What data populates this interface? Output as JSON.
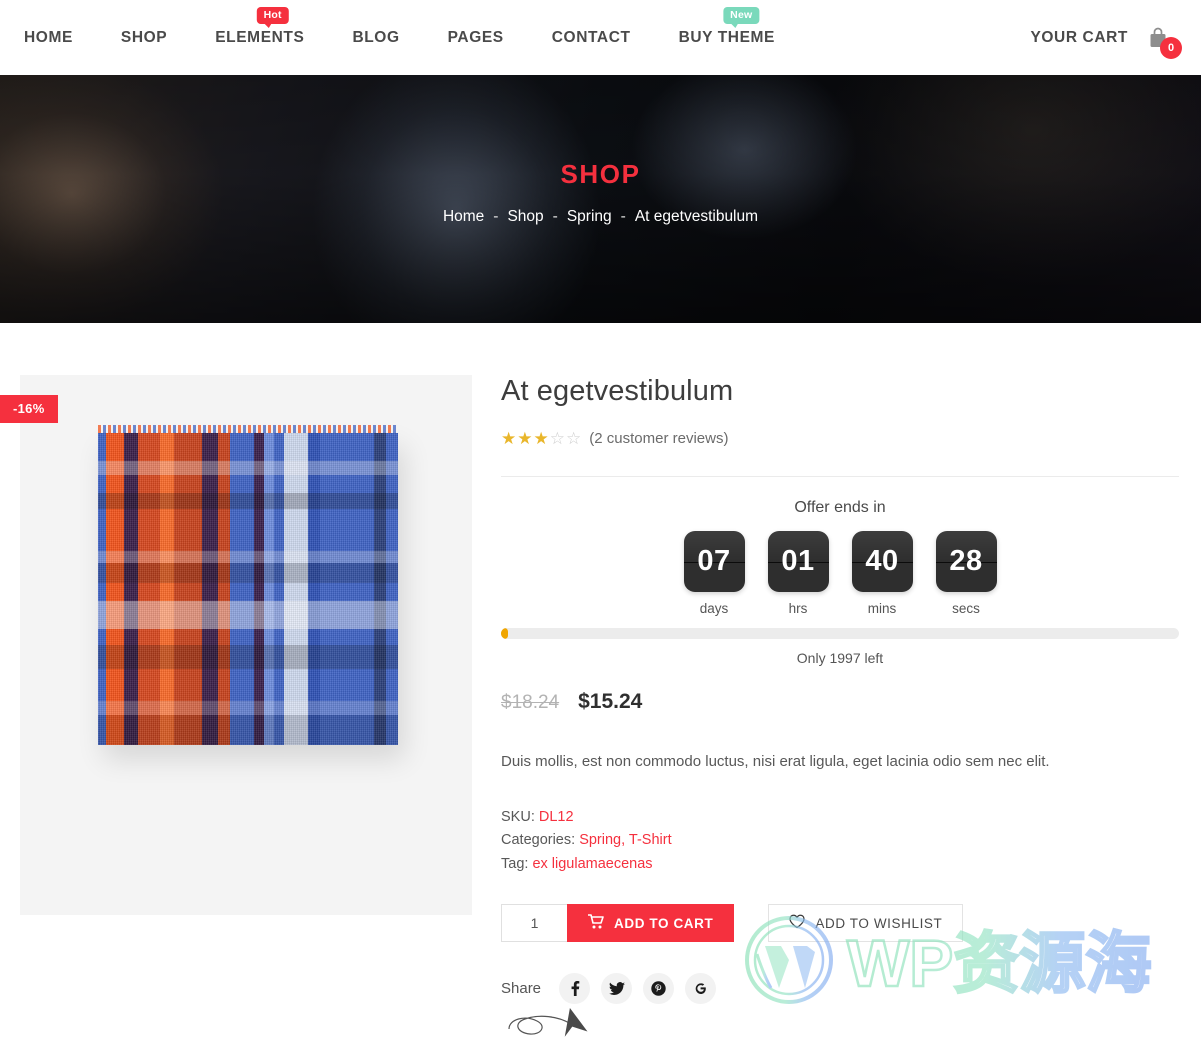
{
  "header": {
    "nav_items": [
      {
        "label": "HOME",
        "badge": null,
        "badge_type": null
      },
      {
        "label": "SHOP",
        "badge": null,
        "badge_type": null
      },
      {
        "label": "ELEMENTS",
        "badge": "Hot",
        "badge_type": "hot"
      },
      {
        "label": "BLOG",
        "badge": null,
        "badge_type": null
      },
      {
        "label": "PAGES",
        "badge": null,
        "badge_type": null
      },
      {
        "label": "CONTACT",
        "badge": null,
        "badge_type": null
      },
      {
        "label": "BUY THEME",
        "badge": "New",
        "badge_type": "new"
      }
    ],
    "cart_label": "YOUR CART",
    "cart_count": "0",
    "cart_icon": "shopping-bag-icon"
  },
  "hero": {
    "title": "SHOP",
    "breadcrumb": [
      {
        "label": "Home",
        "current": false
      },
      {
        "label": "Shop",
        "current": false
      },
      {
        "label": "Spring",
        "current": false
      },
      {
        "label": "At egetvestibulum",
        "current": true
      }
    ],
    "separator": "-"
  },
  "gallery": {
    "sale_badge": "-16%",
    "image_alt": "plaid-scarf-product-photo"
  },
  "product": {
    "title": "At egetvestibulum",
    "rating": {
      "value": 3,
      "max": 5,
      "reviews_text": "(2 customer reviews)"
    },
    "offer": {
      "label": "Offer ends in",
      "units": [
        {
          "value": "07",
          "name": "days"
        },
        {
          "value": "01",
          "name": "hrs"
        },
        {
          "value": "40",
          "name": "mins"
        },
        {
          "value": "28",
          "name": "secs"
        }
      ]
    },
    "stock": {
      "text": "Only 1997 left",
      "percent": 1
    },
    "price": {
      "old": "$18.24",
      "new": "$15.24"
    },
    "description": "Duis mollis, est non commodo luctus, nisi erat ligula, eget lacinia odio sem nec elit.",
    "meta": {
      "sku_label": "SKU:",
      "sku_value": "DL12",
      "categories_label": "Categories:",
      "categories_value": "Spring, T-Shirt",
      "tag_label": "Tag:",
      "tag_value": "ex ligulamaecenas"
    },
    "actions": {
      "quantity": "1",
      "quantity_placeholder": "1",
      "add_to_cart": "ADD TO CART",
      "add_to_wishlist": "ADD TO WISHLIST"
    },
    "share": {
      "label": "Share",
      "networks": [
        {
          "name": "facebook-icon"
        },
        {
          "name": "twitter-icon"
        },
        {
          "name": "pinterest-icon"
        },
        {
          "name": "google-icon"
        }
      ]
    }
  },
  "watermark": {
    "text": "WP资源海"
  },
  "colors": {
    "accent_red": "#f5303e",
    "badge_new": "#7ad9bb",
    "star_gold": "#e9b62b",
    "stock_fill": "#f0a500",
    "countdown_tile": "#2e2e2e"
  }
}
